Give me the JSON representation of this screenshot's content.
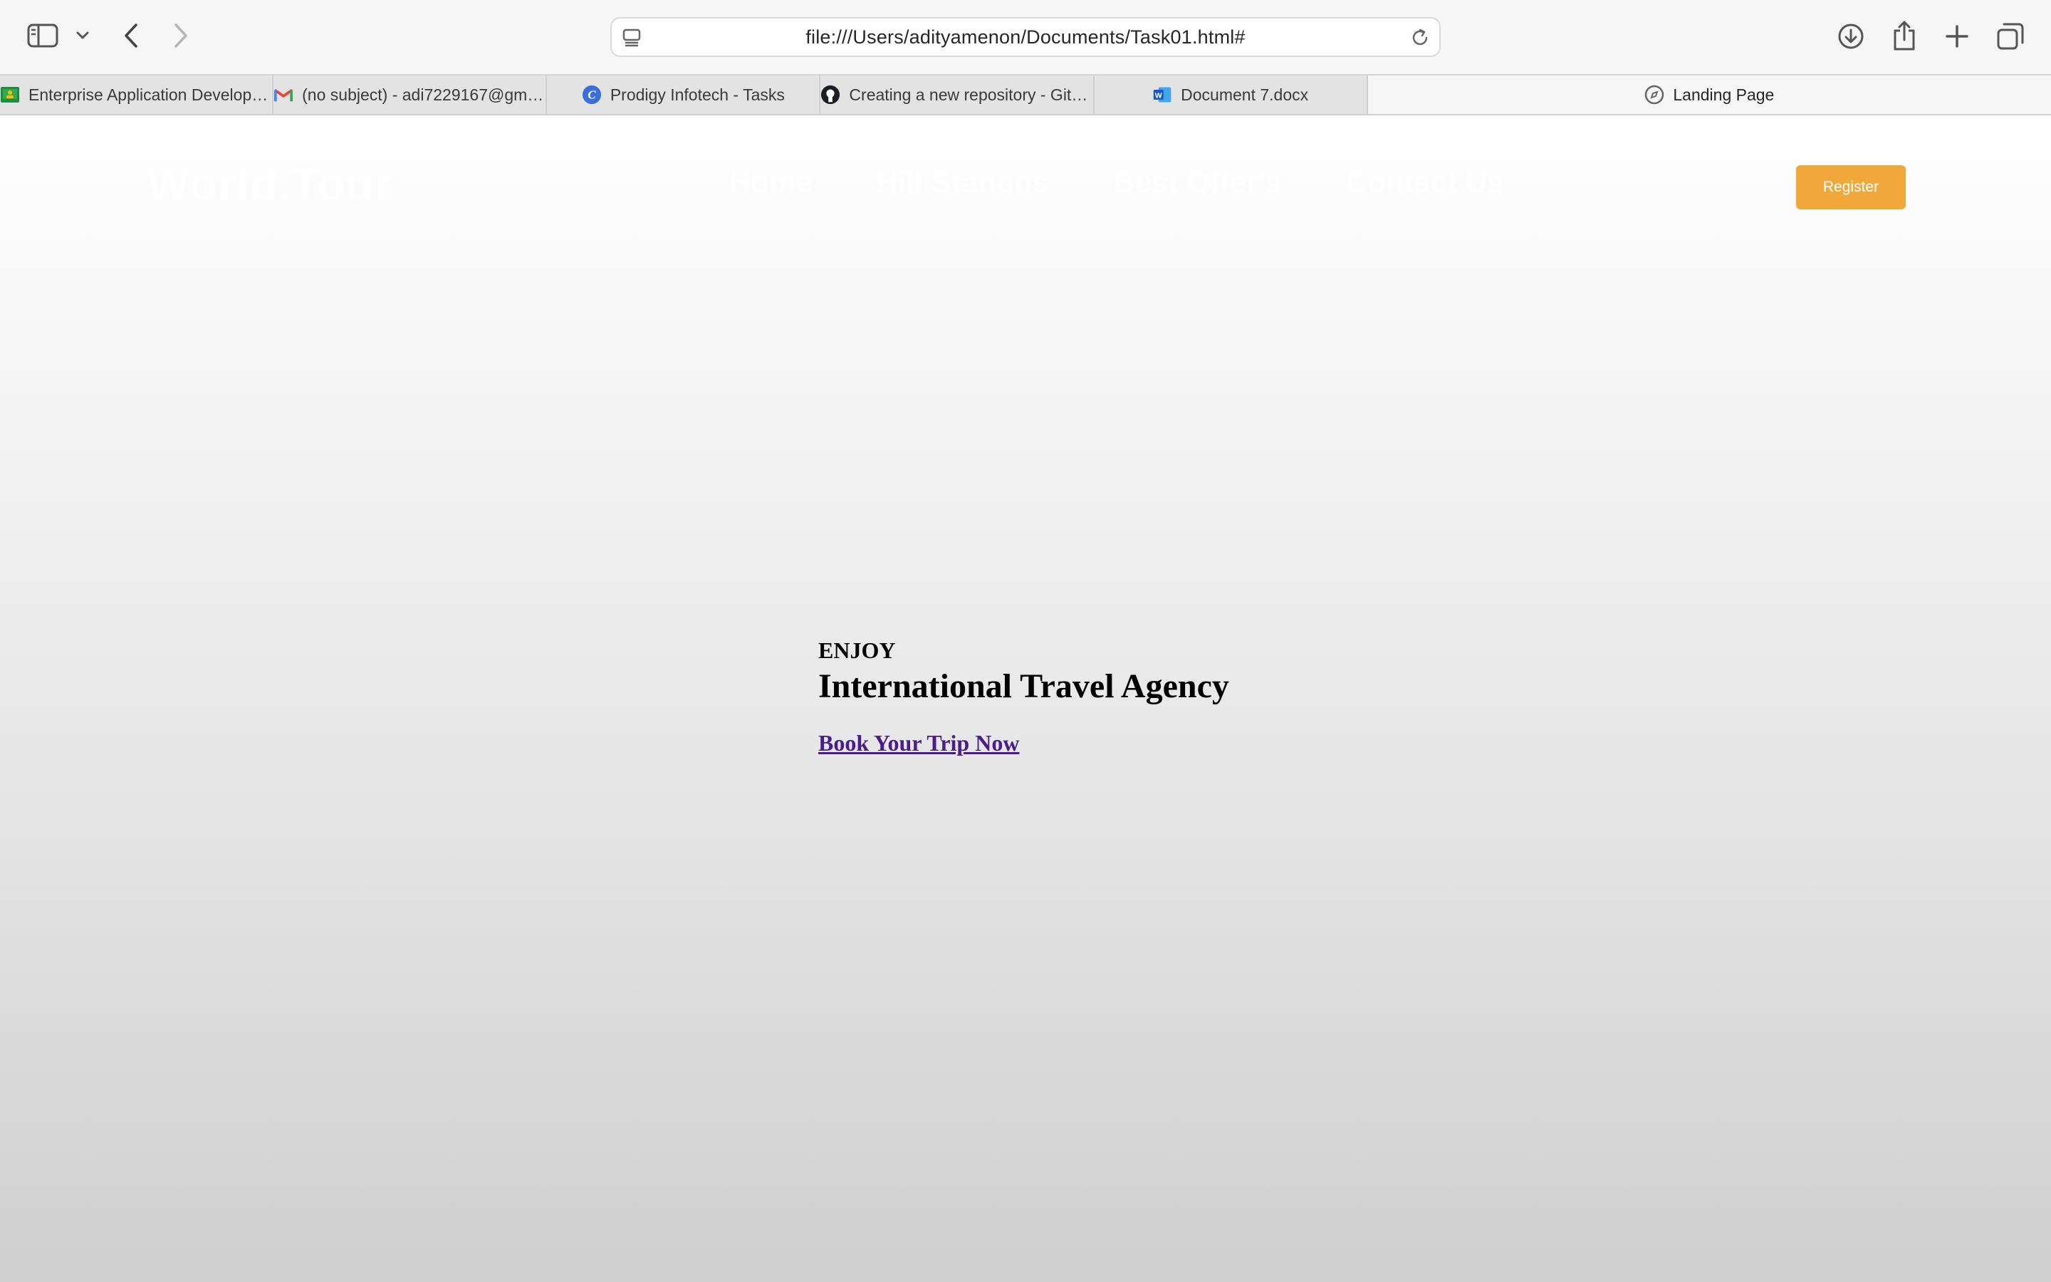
{
  "browser": {
    "url": "file:///Users/adityamenon/Documents/Task01.html#",
    "icons": {
      "sidebar": "sidebar-icon",
      "chevron": "chevron-down-icon",
      "back": "back-arrow-icon",
      "forward": "forward-arrow-icon",
      "page": "page-settings-icon",
      "reload": "reload-icon",
      "download": "download-icon",
      "share": "share-icon",
      "new_tab": "plus-icon",
      "tab_overview": "tab-overview-icon"
    },
    "tabs": [
      {
        "title": "Enterprise Application Developmen...",
        "icon": "google-classroom-icon",
        "active": false
      },
      {
        "title": "(no subject) - adi7229167@gmail....",
        "icon": "gmail-icon",
        "active": false
      },
      {
        "title": "Prodigy Infotech - Tasks",
        "icon": "prodigy-icon",
        "active": false
      },
      {
        "title": "Creating a new repository - GitHu...",
        "icon": "github-icon",
        "active": false
      },
      {
        "title": "Document 7.docx",
        "icon": "word-icon",
        "active": false
      },
      {
        "title": "Landing Page",
        "icon": "compass-icon",
        "active": true
      }
    ]
  },
  "site": {
    "logo": "World.Tour",
    "nav": [
      "Home",
      "Hill Stations",
      "Best Offer's",
      "Contact Us"
    ],
    "register_label": "Register",
    "accent_color": "#f0a83a"
  },
  "hero": {
    "eyebrow": "ENJOY",
    "headline": "International Travel Agency",
    "cta": "Book Your Trip Now",
    "cta_color": "#4a1d8c"
  }
}
